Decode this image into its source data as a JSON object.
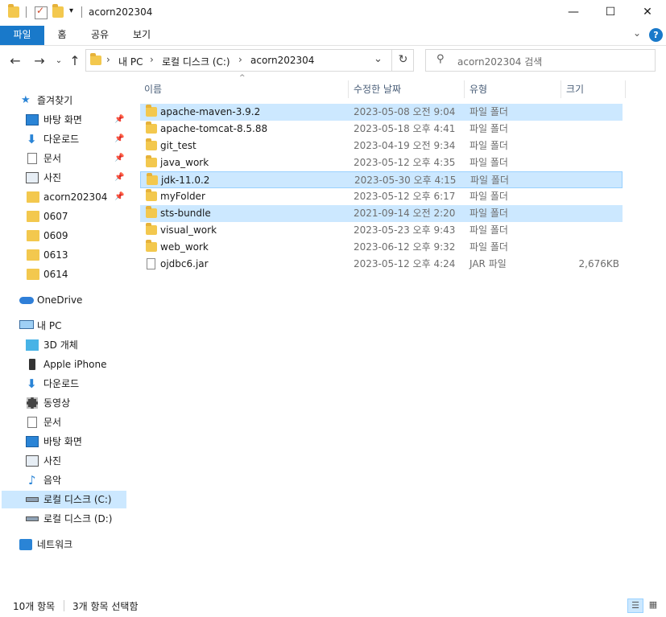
{
  "window": {
    "title": "acorn202304",
    "minimize": "—",
    "maximize": "☐",
    "close": "✕"
  },
  "ribbon": {
    "tabs": [
      "파일",
      "홈",
      "공유",
      "보기"
    ],
    "help": "?"
  },
  "address": {
    "crumbs": [
      "내 PC",
      "로컬 디스크 (C:)",
      "acorn202304"
    ],
    "search_placeholder": "acorn202304 검색"
  },
  "columns": {
    "name": "이름",
    "date": "수정한 날짜",
    "type": "유형",
    "size": "크기"
  },
  "nav": {
    "quick_access": "즐겨찾기",
    "quick_items": [
      {
        "label": "바탕 화면",
        "icon": "desktop-icon",
        "pinned": true
      },
      {
        "label": "다운로드",
        "icon": "download-icon",
        "pinned": true
      },
      {
        "label": "문서",
        "icon": "document-icon",
        "pinned": true
      },
      {
        "label": "사진",
        "icon": "pictures-icon",
        "pinned": true
      },
      {
        "label": "acorn202304",
        "icon": "folder-icon",
        "pinned": true
      },
      {
        "label": "0607",
        "icon": "folder-icon",
        "pinned": false
      },
      {
        "label": "0609",
        "icon": "folder-icon",
        "pinned": false
      },
      {
        "label": "0613",
        "icon": "folder-icon",
        "pinned": false
      },
      {
        "label": "0614",
        "icon": "folder-icon",
        "pinned": false
      }
    ],
    "onedrive": "OneDrive",
    "this_pc": "내 PC",
    "pc_items": [
      {
        "label": "3D 개체",
        "icon": "3d-objects-icon"
      },
      {
        "label": "Apple iPhone",
        "icon": "phone-icon"
      },
      {
        "label": "다운로드",
        "icon": "download-icon"
      },
      {
        "label": "동영상",
        "icon": "video-icon"
      },
      {
        "label": "문서",
        "icon": "document-icon"
      },
      {
        "label": "바탕 화면",
        "icon": "desktop-icon"
      },
      {
        "label": "사진",
        "icon": "pictures-icon"
      },
      {
        "label": "음악",
        "icon": "music-icon"
      },
      {
        "label": "로컬 디스크 (C:)",
        "icon": "drive-icon",
        "selected": true
      },
      {
        "label": "로컬 디스크 (D:)",
        "icon": "drive-icon"
      }
    ],
    "network": "네트워크"
  },
  "files": [
    {
      "name": "apache-maven-3.9.2",
      "date": "2023-05-08 오전 9:04",
      "type": "파일 폴더",
      "size": "",
      "kind": "folder",
      "selected": true
    },
    {
      "name": "apache-tomcat-8.5.88",
      "date": "2023-05-18 오후 4:41",
      "type": "파일 폴더",
      "size": "",
      "kind": "folder",
      "selected": false
    },
    {
      "name": "git_test",
      "date": "2023-04-19 오전 9:34",
      "type": "파일 폴더",
      "size": "",
      "kind": "folder",
      "selected": false
    },
    {
      "name": "java_work",
      "date": "2023-05-12 오후 4:35",
      "type": "파일 폴더",
      "size": "",
      "kind": "folder",
      "selected": false
    },
    {
      "name": "jdk-11.0.2",
      "date": "2023-05-30 오후 4:15",
      "type": "파일 폴더",
      "size": "",
      "kind": "folder",
      "selected": true,
      "focused": true
    },
    {
      "name": "myFolder",
      "date": "2023-05-12 오후 6:17",
      "type": "파일 폴더",
      "size": "",
      "kind": "folder",
      "selected": false
    },
    {
      "name": "sts-bundle",
      "date": "2021-09-14 오전 2:20",
      "type": "파일 폴더",
      "size": "",
      "kind": "folder",
      "selected": true
    },
    {
      "name": "visual_work",
      "date": "2023-05-23 오후 9:43",
      "type": "파일 폴더",
      "size": "",
      "kind": "folder",
      "selected": false
    },
    {
      "name": "web_work",
      "date": "2023-06-12 오후 9:32",
      "type": "파일 폴더",
      "size": "",
      "kind": "folder",
      "selected": false
    },
    {
      "name": "ojdbc6.jar",
      "date": "2023-05-12 오후 4:24",
      "type": "JAR 파일",
      "size": "2,676KB",
      "kind": "file",
      "selected": false
    }
  ],
  "status": {
    "count": "10개 항목",
    "selected": "3개 항목 선택함"
  },
  "colors": {
    "accent": "#1979ca",
    "selection": "#cce8ff",
    "selection_border": "#99d1ff"
  }
}
